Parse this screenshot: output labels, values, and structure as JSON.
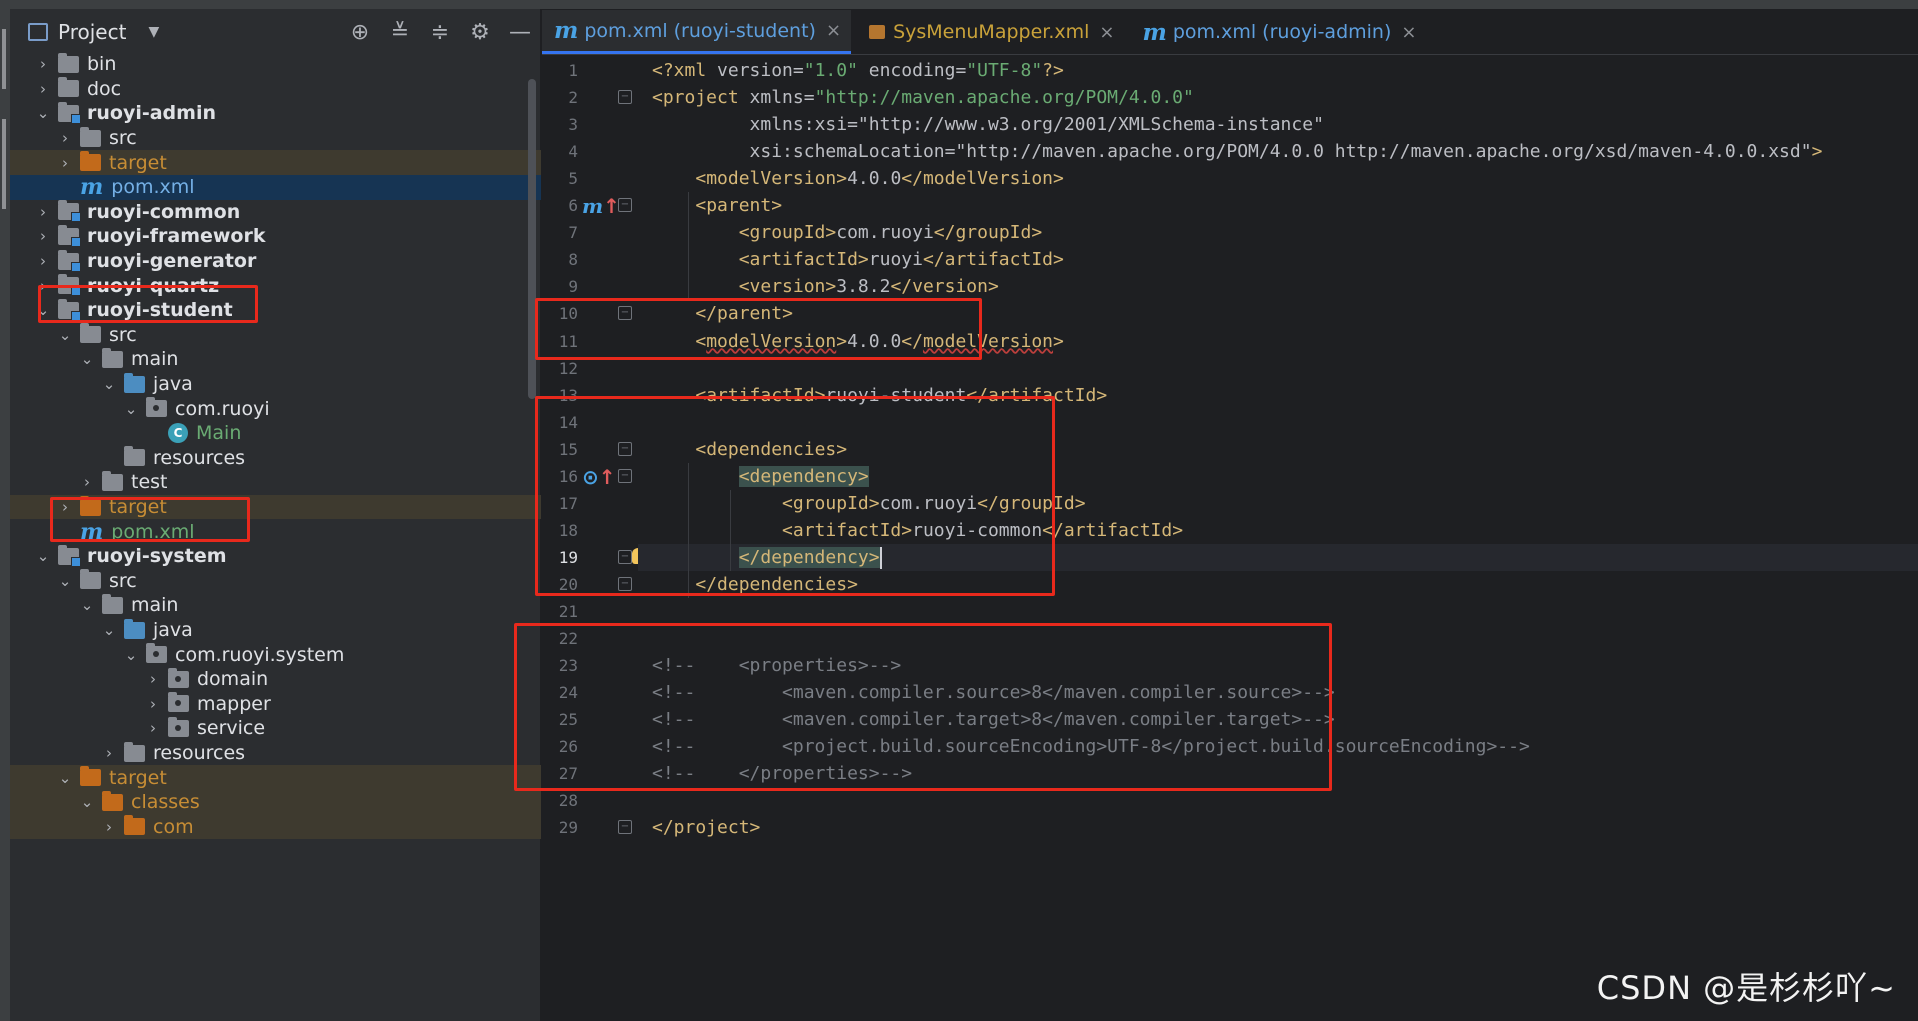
{
  "project_panel": {
    "title": "Project",
    "tool_icons": [
      "crosshair-icon",
      "expand-all-icon",
      "collapse-all-icon",
      "gear-icon",
      "minimize-icon"
    ],
    "tree": [
      {
        "label": "bin",
        "depth": 1,
        "chev": "›",
        "kind": "folder",
        "style": "norm"
      },
      {
        "label": "doc",
        "depth": 1,
        "chev": "›",
        "kind": "folder",
        "style": "norm"
      },
      {
        "label": "ruoyi-admin",
        "depth": 1,
        "chev": "⌄",
        "kind": "module",
        "style": "bold"
      },
      {
        "label": "src",
        "depth": 2,
        "chev": "›",
        "kind": "folder",
        "style": "norm"
      },
      {
        "label": "target",
        "depth": 2,
        "chev": "›",
        "kind": "orange",
        "style": "orange",
        "row": "hl-target"
      },
      {
        "label": "pom.xml",
        "depth": 2,
        "chev": "",
        "kind": "maven",
        "style": "blue",
        "row": "selected"
      },
      {
        "label": "ruoyi-common",
        "depth": 1,
        "chev": "›",
        "kind": "module",
        "style": "bold"
      },
      {
        "label": "ruoyi-framework",
        "depth": 1,
        "chev": "›",
        "kind": "module",
        "style": "bold"
      },
      {
        "label": "ruoyi-generator",
        "depth": 1,
        "chev": "›",
        "kind": "module",
        "style": "bold"
      },
      {
        "label": "ruoyi-quartz",
        "depth": 1,
        "chev": "›",
        "kind": "module",
        "style": "bold"
      },
      {
        "label": "ruoyi-student",
        "depth": 1,
        "chev": "⌄",
        "kind": "module",
        "style": "bold"
      },
      {
        "label": "src",
        "depth": 2,
        "chev": "⌄",
        "kind": "folder",
        "style": "norm"
      },
      {
        "label": "main",
        "depth": 3,
        "chev": "⌄",
        "kind": "folder",
        "style": "norm"
      },
      {
        "label": "java",
        "depth": 4,
        "chev": "⌄",
        "kind": "blue",
        "style": "norm"
      },
      {
        "label": "com.ruoyi",
        "depth": 5,
        "chev": "⌄",
        "kind": "pkg",
        "style": "norm"
      },
      {
        "label": "Main",
        "depth": 6,
        "chev": "",
        "kind": "class",
        "style": "green"
      },
      {
        "label": "resources",
        "depth": 4,
        "chev": "",
        "kind": "folder",
        "style": "norm"
      },
      {
        "label": "test",
        "depth": 3,
        "chev": "›",
        "kind": "folder",
        "style": "norm"
      },
      {
        "label": "target",
        "depth": 2,
        "chev": "›",
        "kind": "orange",
        "style": "orange",
        "row": "hl-target"
      },
      {
        "label": "pom.xml",
        "depth": 2,
        "chev": "",
        "kind": "maven",
        "style": "green"
      },
      {
        "label": "ruoyi-system",
        "depth": 1,
        "chev": "⌄",
        "kind": "module",
        "style": "bold"
      },
      {
        "label": "src",
        "depth": 2,
        "chev": "⌄",
        "kind": "folder",
        "style": "norm"
      },
      {
        "label": "main",
        "depth": 3,
        "chev": "⌄",
        "kind": "folder",
        "style": "norm"
      },
      {
        "label": "java",
        "depth": 4,
        "chev": "⌄",
        "kind": "blue",
        "style": "norm"
      },
      {
        "label": "com.ruoyi.system",
        "depth": 5,
        "chev": "⌄",
        "kind": "pkg",
        "style": "norm"
      },
      {
        "label": "domain",
        "depth": 6,
        "chev": "›",
        "kind": "pkg",
        "style": "norm"
      },
      {
        "label": "mapper",
        "depth": 6,
        "chev": "›",
        "kind": "pkg",
        "style": "norm"
      },
      {
        "label": "service",
        "depth": 6,
        "chev": "›",
        "kind": "pkg",
        "style": "norm"
      },
      {
        "label": "resources",
        "depth": 4,
        "chev": "›",
        "kind": "folder",
        "style": "norm"
      },
      {
        "label": "target",
        "depth": 2,
        "chev": "⌄",
        "kind": "orange",
        "style": "orange",
        "row": "hl-target"
      },
      {
        "label": "classes",
        "depth": 3,
        "chev": "⌄",
        "kind": "orange",
        "style": "orange",
        "row": "hl-target"
      },
      {
        "label": "com",
        "depth": 4,
        "chev": "›",
        "kind": "orange",
        "style": "orange",
        "row": "hl-target"
      }
    ]
  },
  "tabs": [
    {
      "label": "pom.xml (ruoyi-student)",
      "icon": "maven-icon",
      "active": true,
      "color": "blue"
    },
    {
      "label": "SysMenuMapper.xml",
      "icon": "xml-file-icon",
      "active": false,
      "color": "yellow"
    },
    {
      "label": "pom.xml (ruoyi-admin)",
      "icon": "maven-icon",
      "active": false,
      "color": "blue"
    }
  ],
  "tab_icon_glyph": "m",
  "close_glyph": "×",
  "gutter_mark_line6": "m↑",
  "gutter_mark_line16": "⊙↑",
  "current_line": 19,
  "code_lines": [
    "<?xml version=\"1.0\" encoding=\"UTF-8\"?>",
    "<project xmlns=\"http://maven.apache.org/POM/4.0.0\"",
    "         xmlns:xsi=\"http://www.w3.org/2001/XMLSchema-instance\"",
    "         xsi:schemaLocation=\"http://maven.apache.org/POM/4.0.0 http://maven.apache.org/xsd/maven-4.0.0.xsd\">",
    "    <modelVersion>4.0.0</modelVersion>",
    "    <parent>",
    "        <groupId>com.ruoyi</groupId>",
    "        <artifactId>ruoyi</artifactId>",
    "        <version>3.8.2</version>",
    "    </parent>",
    "    <modelVersion>4.0.0</modelVersion>",
    "",
    "    <artifactId>ruoyi-student</artifactId>",
    "",
    "    <dependencies>",
    "        <dependency>",
    "            <groupId>com.ruoyi</groupId>",
    "            <artifactId>ruoyi-common</artifactId>",
    "        </dependency>",
    "    </dependencies>",
    "",
    "",
    "<!--    <properties>-->",
    "<!--        <maven.compiler.source>8</maven.compiler.source>-->",
    "<!--        <maven.compiler.target>8</maven.compiler.target>-->",
    "<!--        <project.build.sourceEncoding>UTF-8</project.build.sourceEncoding>-->",
    "<!--    </properties>-->",
    "",
    "</project>"
  ],
  "watermark": "CSDN @是杉杉吖~"
}
